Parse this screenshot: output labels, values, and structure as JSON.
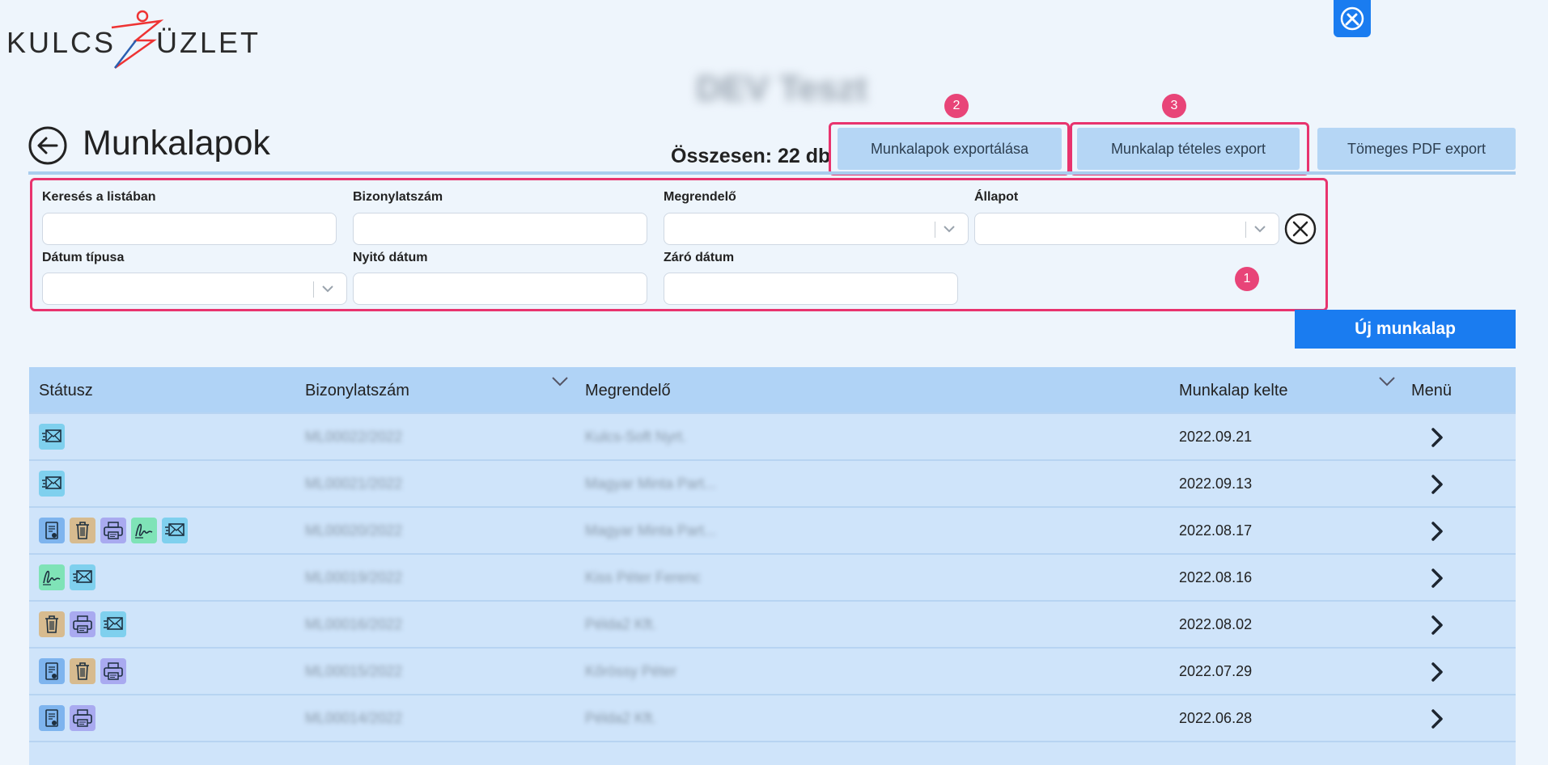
{
  "app": {
    "logo_left": "KULCS",
    "logo_right": "ÜZLET",
    "company_name_blurred": "DEV Teszt"
  },
  "header": {
    "title": "Munkalapok",
    "total_label": "Összesen: 22 db",
    "export_buttons": [
      "Munkalapok exportálása",
      "Munkalap tételes export",
      "Tömeges PDF export"
    ],
    "new_button": "Új munkalap"
  },
  "badges": [
    "1",
    "2",
    "3"
  ],
  "filters": {
    "search_label": "Keresés a listában",
    "doc_no_label": "Bizonylatszám",
    "customer_label": "Megrendelő",
    "status_label": "Állapot",
    "date_type_label": "Dátum típusa",
    "open_date_label": "Nyitó dátum",
    "close_date_label": "Záró dátum"
  },
  "table": {
    "headers": [
      "Státusz",
      "Bizonylatszám",
      "Megrendelő",
      "Munkalap kelte",
      "Menü"
    ],
    "rows": [
      {
        "icons": [
          "mail-icon"
        ],
        "doc_no": "ML00022/2022",
        "customer": "Kulcs-Soft Nyrt.",
        "date": "2022.09.21"
      },
      {
        "icons": [
          "mail-icon"
        ],
        "doc_no": "ML00021/2022",
        "customer": "Magyar Minta Part...",
        "date": "2022.09.13"
      },
      {
        "icons": [
          "document-icon",
          "trash-icon",
          "printer-icon",
          "signature-icon",
          "mail-icon"
        ],
        "doc_no": "ML00020/2022",
        "customer": "Magyar Minta Part...",
        "date": "2022.08.17"
      },
      {
        "icons": [
          "signature-icon",
          "mail-icon"
        ],
        "doc_no": "ML00019/2022",
        "customer": "Kiss Péter Ferenc",
        "date": "2022.08.16"
      },
      {
        "icons": [
          "trash-icon",
          "printer-icon",
          "mail-icon"
        ],
        "doc_no": "ML00016/2022",
        "customer": "Példa2 Kft.",
        "date": "2022.08.02"
      },
      {
        "icons": [
          "document-icon",
          "trash-icon",
          "printer-icon"
        ],
        "doc_no": "ML00015/2022",
        "customer": "Kőrössy Péter",
        "date": "2022.07.29"
      },
      {
        "icons": [
          "document-icon",
          "printer-icon"
        ],
        "doc_no": "ML00014/2022",
        "customer": "Példa2 Kft.",
        "date": "2022.06.28"
      }
    ]
  },
  "colors": {
    "primary": "#1a7cf0",
    "highlight": "#e8336e",
    "header_row": "#b0d3f6",
    "row": "#cfe4fa"
  }
}
